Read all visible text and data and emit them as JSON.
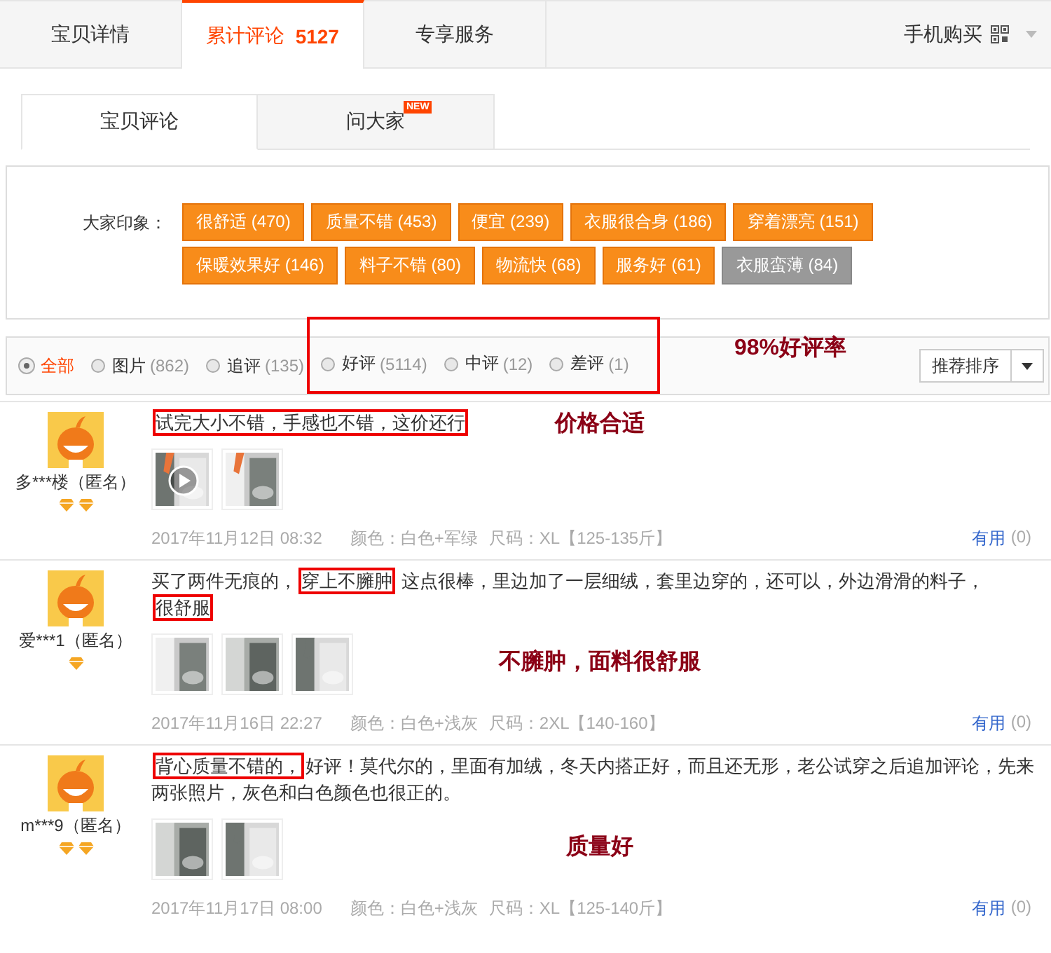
{
  "main_tabs": [
    {
      "label": "宝贝详情",
      "selected": false
    },
    {
      "label": "累计评论",
      "count": "5127",
      "selected": true
    },
    {
      "label": "专享服务",
      "selected": false
    }
  ],
  "mobile_buy": "手机购买",
  "sub_tabs": [
    {
      "label": "宝贝评论",
      "selected": true
    },
    {
      "label": "问大家",
      "badge": "NEW",
      "selected": false
    }
  ],
  "impressions": {
    "label": "大家印象：",
    "tags": [
      {
        "text": "很舒适 (470)",
        "positive": true
      },
      {
        "text": "质量不错 (453)",
        "positive": true
      },
      {
        "text": "便宜 (239)",
        "positive": true
      },
      {
        "text": "衣服很合身 (186)",
        "positive": true
      },
      {
        "text": "穿着漂亮 (151)",
        "positive": true
      },
      {
        "text": "保暖效果好 (146)",
        "positive": true
      },
      {
        "text": "料子不错 (80)",
        "positive": true
      },
      {
        "text": "物流快 (68)",
        "positive": true
      },
      {
        "text": "服务好 (61)",
        "positive": true
      },
      {
        "text": "衣服蛮薄 (84)",
        "positive": false
      }
    ]
  },
  "filters": [
    {
      "label": "全部",
      "selected": true,
      "boxed": false
    },
    {
      "label": "图片",
      "count": "(862)",
      "selected": false,
      "boxed": false
    },
    {
      "label": "追评",
      "count": "(135)",
      "selected": false,
      "boxed": false
    },
    {
      "label": "好评",
      "count": "(5114)",
      "selected": false,
      "boxed": true
    },
    {
      "label": "中评",
      "count": "(12)",
      "selected": false,
      "boxed": true
    },
    {
      "label": "差评",
      "count": "(1)",
      "selected": false,
      "boxed": true
    }
  ],
  "filter_note": "98%好评率",
  "sort_button": "推荐排序",
  "reviews": [
    {
      "user": "多***楼（匿名）",
      "badges": [
        {
          "kind": "diamond"
        },
        {
          "kind": "diamond"
        }
      ],
      "text": [
        {
          "text": "试完大小不错，手感也不错，这价还行",
          "highlighted": true
        }
      ],
      "note": {
        "text": "价格合适",
        "kind": "inline"
      },
      "photos": [
        {
          "kind": "video"
        },
        {
          "kind": "picture"
        }
      ],
      "date": "2017年11月12日 08:32",
      "color_spec": "颜色：白色+军绿",
      "size": "尺码：XL【125-135斤】",
      "helpful": "有用",
      "helpful_count": "(0)"
    },
    {
      "user": "爱***1（匿名）",
      "badges": [
        {
          "kind": "diamond"
        }
      ],
      "text": [
        {
          "text": "买了两件无痕的，",
          "highlighted": false
        },
        {
          "text": "穿上不臃肿",
          "highlighted": true
        },
        {
          "text": "  这点很棒，里边加了一层细绒，套里边穿的，还可以，外边滑滑的料子，",
          "highlighted": false
        },
        {
          "text": "很舒服",
          "highlighted": true
        }
      ],
      "note": {
        "text": "不臃肿，面料很舒服",
        "kind": "photos"
      },
      "photos": [
        {
          "kind": "picture"
        },
        {
          "kind": "picture"
        },
        {
          "kind": "picture"
        }
      ],
      "date": "2017年11月16日 22:27",
      "color_spec": "颜色：白色+浅灰",
      "size": "尺码：2XL【140-160】",
      "helpful": "有用",
      "helpful_count": "(0)"
    },
    {
      "user": "m***9（匿名）",
      "badges": [
        {
          "kind": "diamond"
        },
        {
          "kind": "diamond"
        }
      ],
      "text": [
        {
          "text": "背心质量不错的，",
          "highlighted": true
        },
        {
          "text": "好评！莫代尔的，里面有加绒，冬天内搭正好，而且还无形，老公试穿之后追加评论，先来两张照片，灰色和白色颜色也很正的。",
          "highlighted": false
        }
      ],
      "note": {
        "text": "质量好",
        "kind": "photos"
      },
      "photos": [
        {
          "kind": "picture"
        },
        {
          "kind": "picture"
        }
      ],
      "date": "2017年11月17日 08:00",
      "color_spec": "颜色：白色+浅灰",
      "size": "尺码：XL【125-140斤】",
      "helpful": "有用",
      "helpful_count": "(0)"
    }
  ]
}
